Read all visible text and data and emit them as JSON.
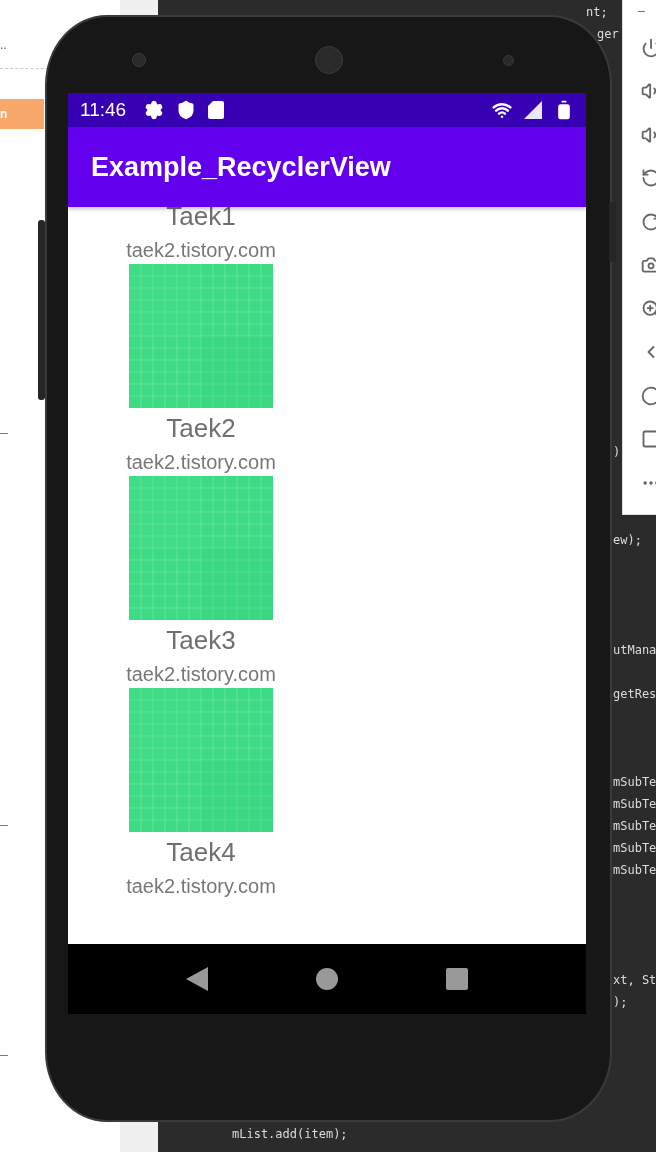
{
  "ide": {
    "left_panel": {
      "ellipsis": "..",
      "highlight_text": "n"
    },
    "code_fragments": [
      "nt;",
      "ger",
      ")",
      "ew);",
      "utMana",
      "getRes",
      "mSubTe",
      "mSubTe",
      "mSubTe",
      "mSubTe",
      "mSubTe",
      "xt, St",
      ");",
      "mList.add(item);"
    ],
    "emulator_toolbar": {
      "minimize": "−"
    }
  },
  "phone": {
    "status_bar": {
      "time": "11:46"
    },
    "app_bar": {
      "title": "Example_RecyclerView"
    },
    "items": [
      {
        "title": "Taek1",
        "subtitle": "taek2.tistory.com"
      },
      {
        "title": "Taek2",
        "subtitle": "taek2.tistory.com"
      },
      {
        "title": "Taek3",
        "subtitle": "taek2.tistory.com"
      },
      {
        "title": "Taek4",
        "subtitle": "taek2.tistory.com"
      }
    ]
  }
}
